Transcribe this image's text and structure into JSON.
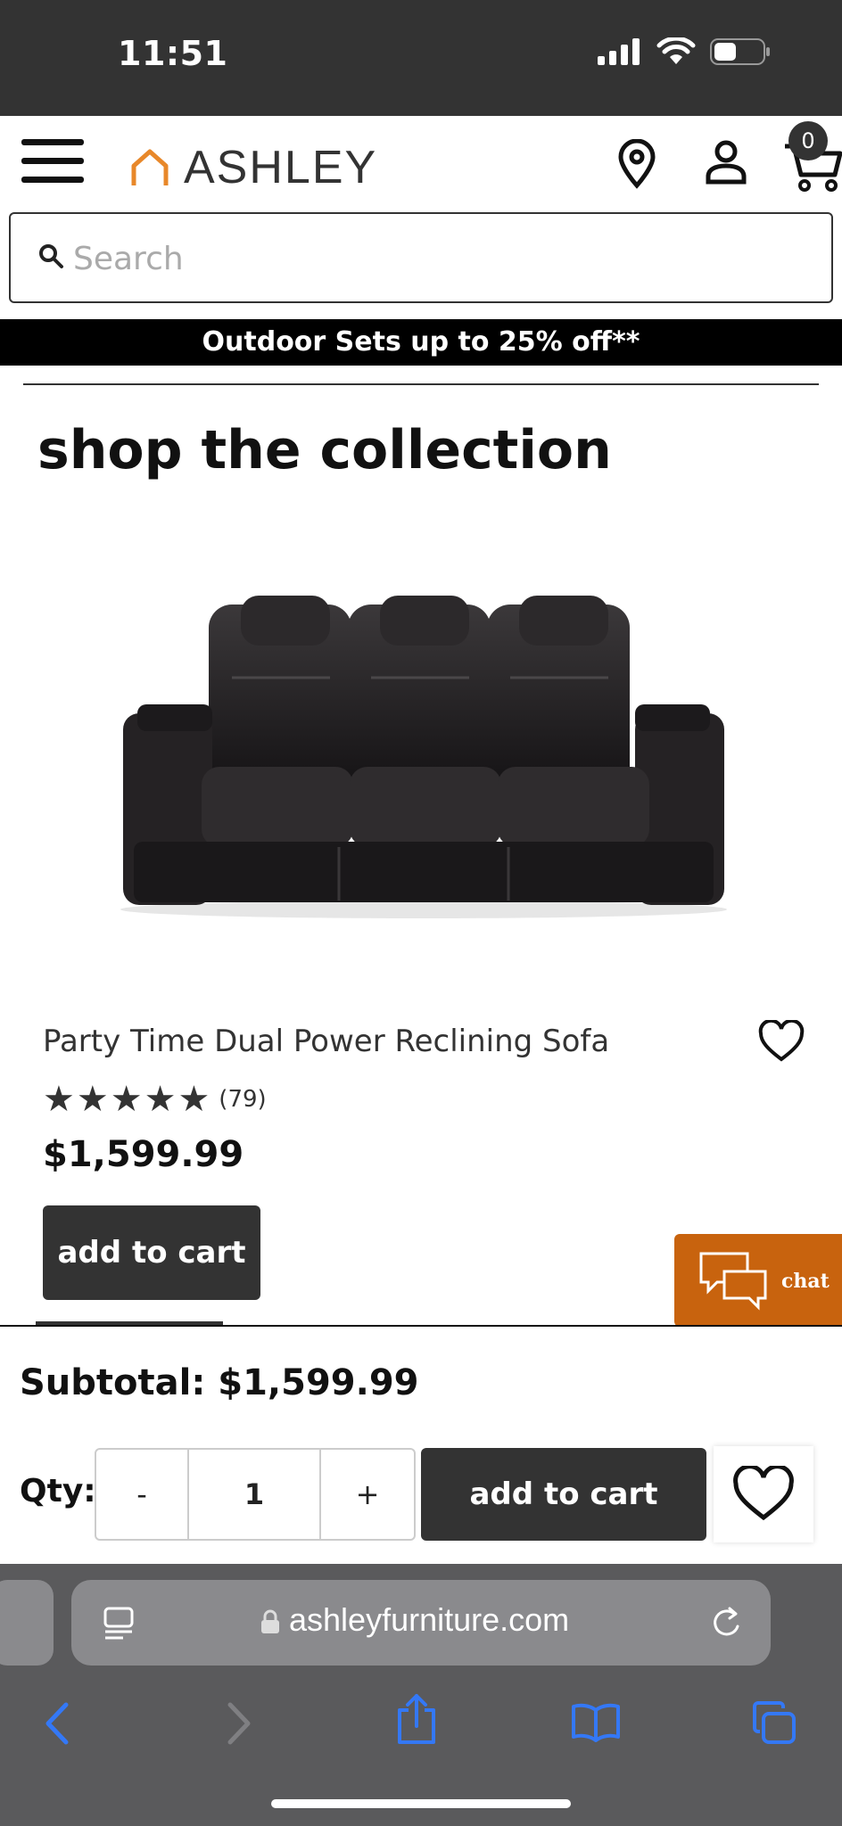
{
  "status_bar": {
    "time": "11:51"
  },
  "header": {
    "brand": "ASHLEY",
    "cart_count": "0"
  },
  "search": {
    "placeholder": "Search"
  },
  "promo": {
    "text": "Outdoor Sets up to 25% off**"
  },
  "section": {
    "title": "shop the collection"
  },
  "product": {
    "name": "Party Time Dual Power Reclining Sofa",
    "rating": 5,
    "rating_stars": "★★★★★",
    "review_count": "(79)",
    "price": "$1,599.99",
    "add_to_cart_label": "add to cart"
  },
  "chat": {
    "label": "chat"
  },
  "sticky": {
    "subtotal": "Subtotal: $1,599.99",
    "qty_label": "Qty:",
    "minus_label": "-",
    "qty_value": "1",
    "plus_label": "+",
    "add_to_cart_label": "add to cart"
  },
  "browser": {
    "url": "ashleyfurniture.com"
  },
  "colors": {
    "accent": "#c8630e",
    "dark": "#333333",
    "ios_link": "#3478f6"
  }
}
